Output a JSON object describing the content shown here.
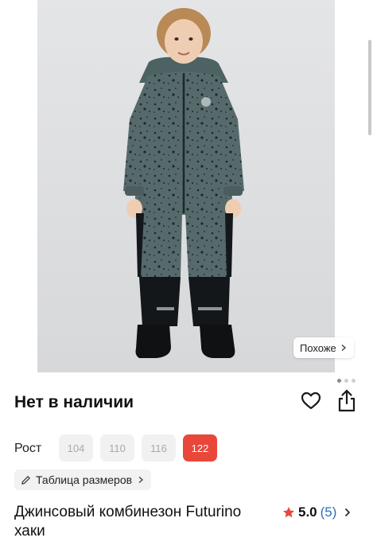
{
  "gallery": {
    "similar_label": "Похоже",
    "page_count": 3,
    "active_page": 1
  },
  "product": {
    "availability": "Нет в наличии",
    "title": "Джинсовый комбинезон Futurino хаки",
    "rating": "5.0",
    "reviews": "(5)"
  },
  "sizes": {
    "label": "Рост",
    "options": [
      "104",
      "110",
      "116",
      "122"
    ],
    "selected": "122",
    "size_table_label": "Таблица размеров"
  },
  "colors": {
    "accent": "#e8473a",
    "rating_count": "#2e6fb5",
    "chip_bg": "#f1f1f2",
    "chip_text": "#a9a9ab"
  },
  "icons": {
    "favorite": "heart-icon",
    "share": "share-icon",
    "rating": "star-icon",
    "size_table": "pencil-icon"
  }
}
